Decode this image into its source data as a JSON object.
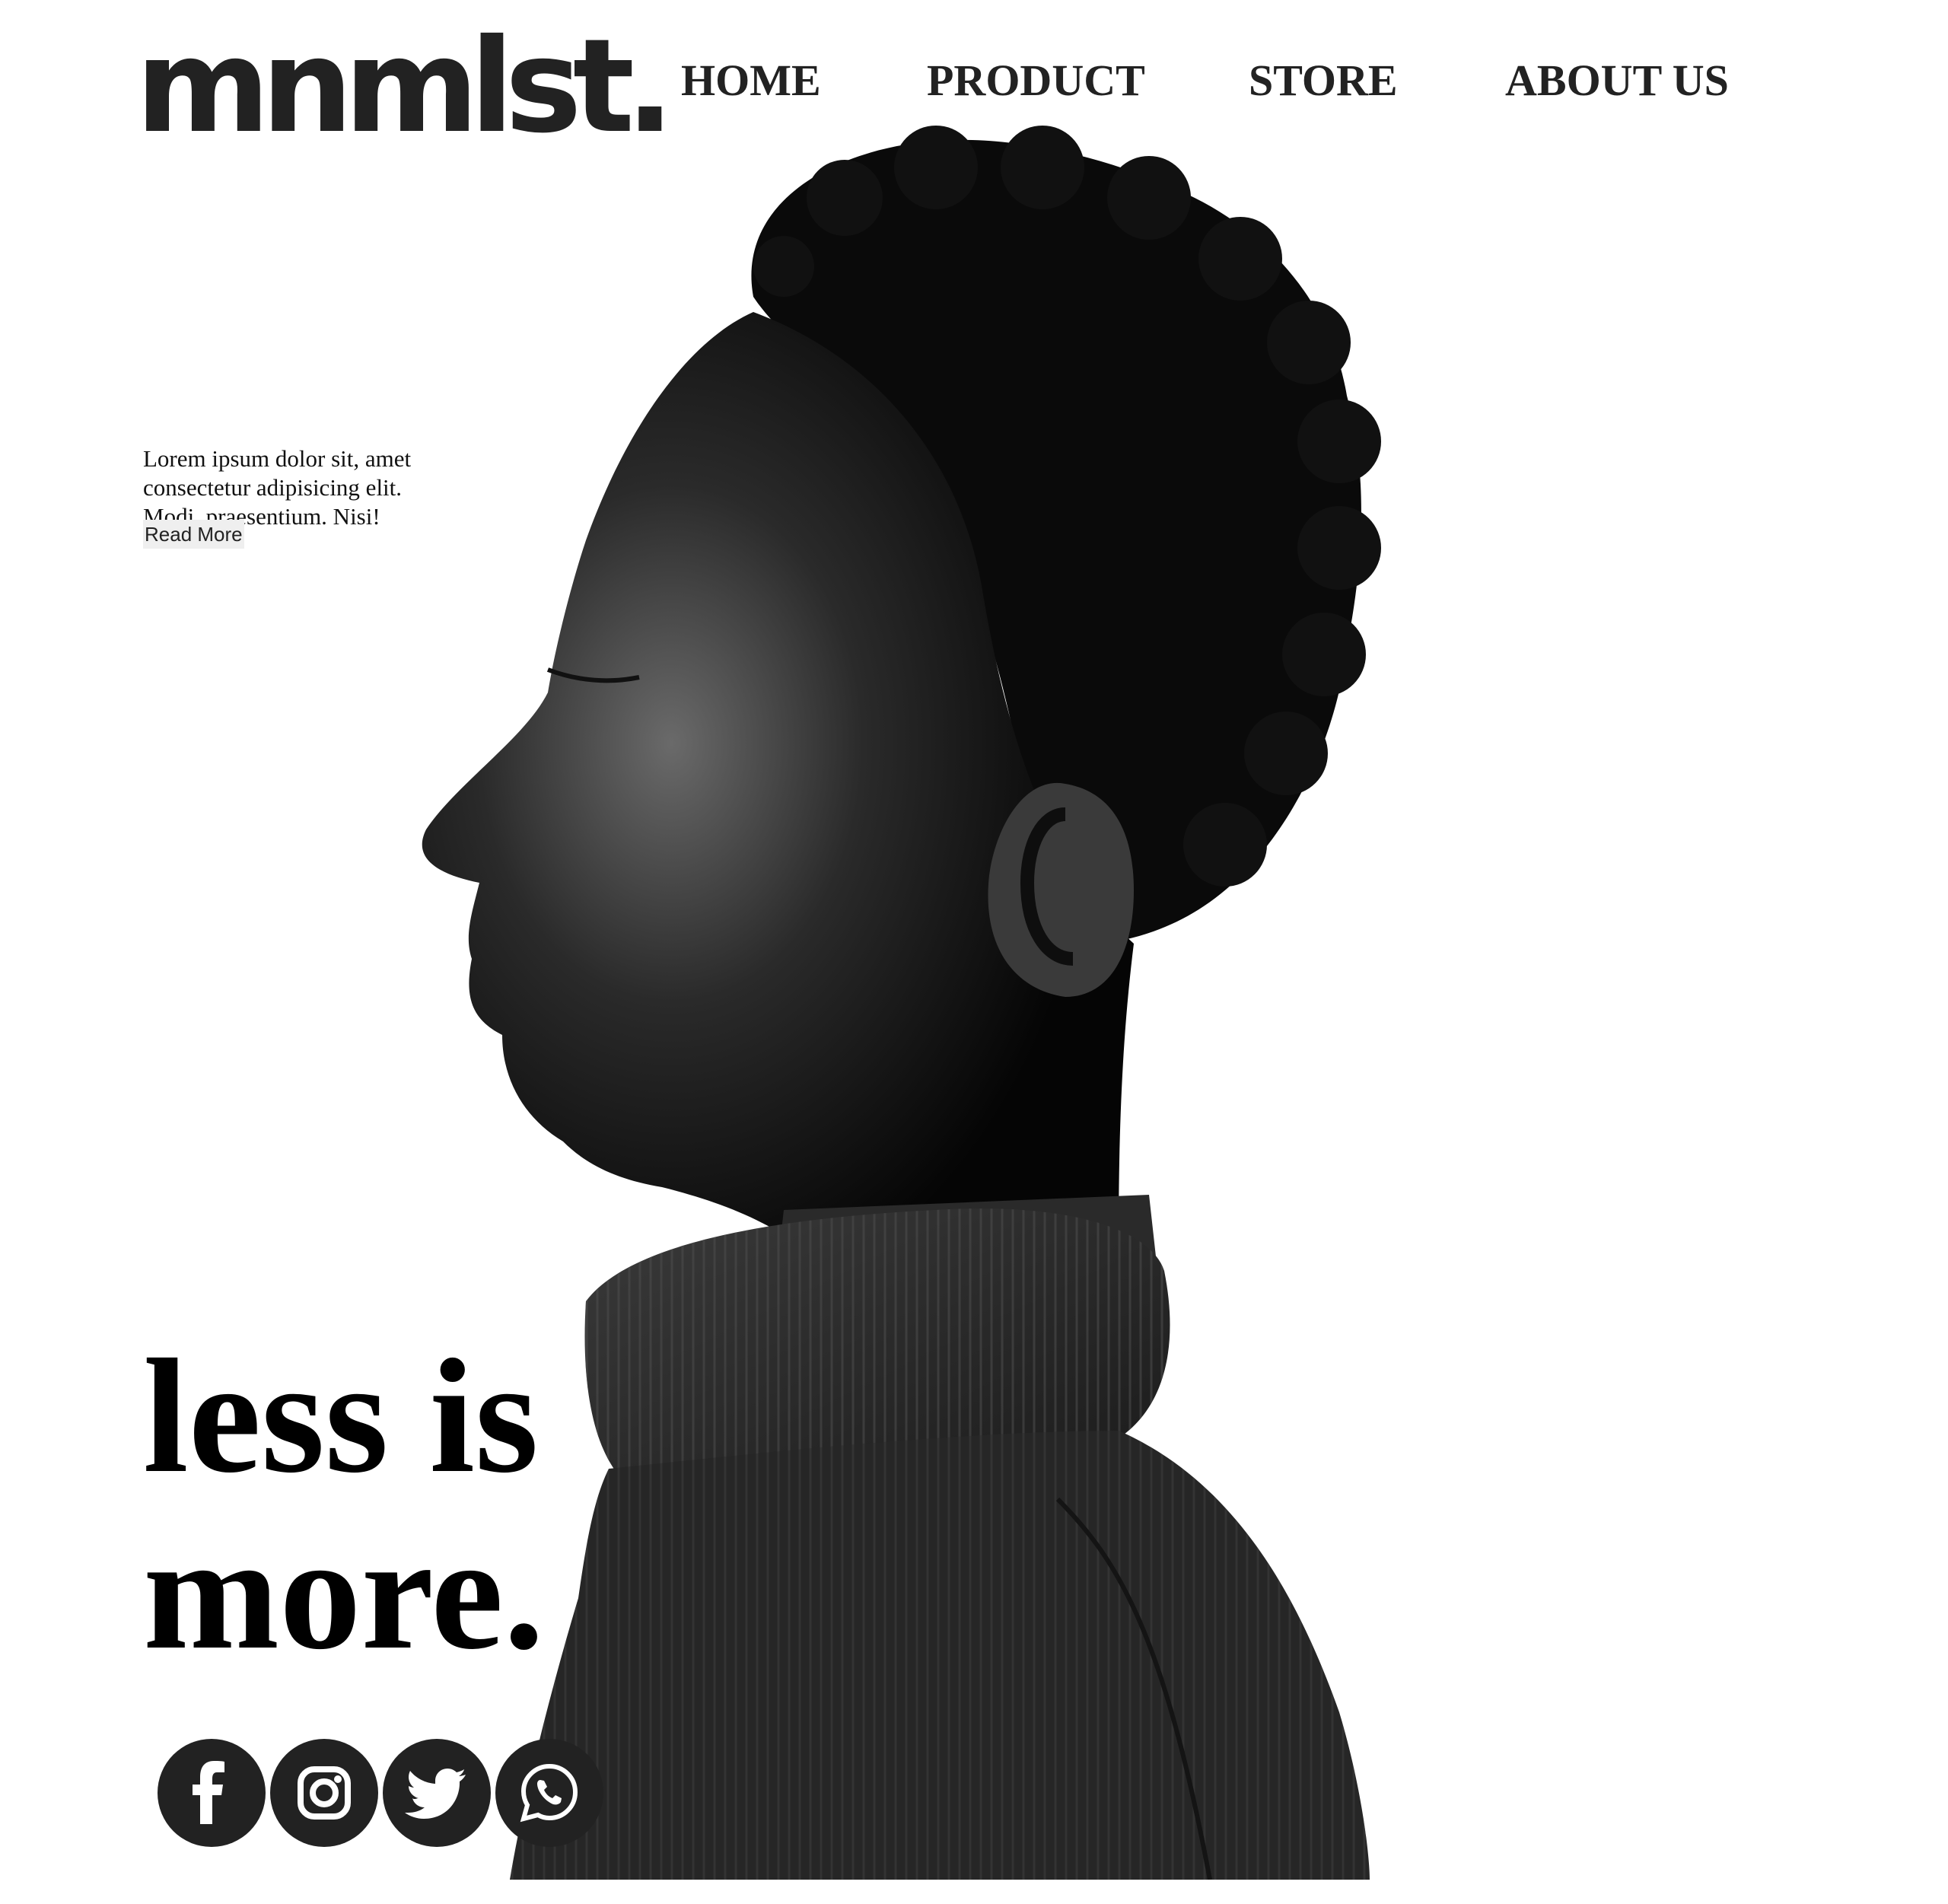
{
  "brand": {
    "logo_text": "mnmlst."
  },
  "nav": {
    "items": [
      {
        "label": "HOME"
      },
      {
        "label": "PRODUCT"
      },
      {
        "label": "STORE"
      },
      {
        "label": "ABOUT US"
      }
    ]
  },
  "hero": {
    "intro_text": "Lorem ipsum dolor sit, amet consectetur adipisicing elit. Modi, praesentium. Nisi!",
    "read_more_label": "Read More",
    "tagline_line1": "less is",
    "tagline_line2": "more."
  },
  "socials": [
    {
      "icon": "facebook-icon"
    },
    {
      "icon": "instagram-icon"
    },
    {
      "icon": "twitter-icon"
    },
    {
      "icon": "whatsapp-icon"
    }
  ],
  "colors": {
    "background": "#ffffff",
    "text": "#111111",
    "icon_circle": "#222222"
  }
}
